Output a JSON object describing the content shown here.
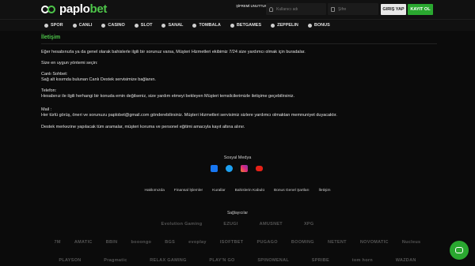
{
  "header": {
    "logo": {
      "part1": "paplo",
      "part2": "bet"
    },
    "forgot_password": "ŞİFREMİ UNUTTUM",
    "username_placeholder": "Kullanıcı adı",
    "password_placeholder": "Şifre",
    "login_label": "GIRIŞ YAP",
    "register_label": "KAYIT OL"
  },
  "nav": {
    "items": [
      "SPOR",
      "CANLI",
      "CASINO",
      "SLOT",
      "SANAL",
      "TOMBALA",
      "BETGAMES",
      "ZEPPELIN",
      "BONUS"
    ]
  },
  "page": {
    "title": "İletişim",
    "intro": "Eğer hesabınızla ya da genel olarak bahislerle ilgili bir sorunuz varsa, Müşteri Hizmetleri ekibimiz 7/24 size yardımcı olmak için buradalar.",
    "methods_heading": "Size en uygun yöntemi seçin:",
    "live_chat_title": "Canlı Sohbet:",
    "live_chat_text": "Sağ alt kısımda bulunan Canlı Destek servisimize bağlanın.",
    "phone_title": "Telefon:",
    "phone_text": "Hesabınız ile ilgili herhangi bir konuda emin değilseniz, size yardım etmeyi bekleyen Müşteri temsilcilerimizle iletişime geçebilirsiniz.",
    "mail_title": "Mail :",
    "mail_text": "Her türlü görüş, öneri ve sorunuzu paplobet@gmail.com gönderebilirsiniz. Müşteri Hizmetleri servisimiz sizlere yardımcı olmaktan memnuniyet duyacaktır.",
    "note": "Destek merkezine yapılacak tüm aramalar, müşteri koruma ve personel eğitimi amacıyla kayıt altına alınır."
  },
  "footer": {
    "social_title": "Sosyal Medya",
    "social_icons": [
      "facebook-icon",
      "twitter-icon",
      "instagram-icon",
      "youtube-icon"
    ],
    "links": [
      "Hakkımızda",
      "Finansal İşlemler",
      "Kurallar",
      "Bahislerin Kabulü",
      "Bonus Genel Şartları",
      "İletişim"
    ],
    "providers_title": "Sağlayıcılar",
    "providers_row1": [
      "Evolution Gaming",
      "EZUGI",
      "AMUSNET",
      "XPG"
    ],
    "providers_row2": [
      "7M",
      "AMATIC",
      "BBIN",
      "booongo",
      "BGS",
      "evoplay",
      "ISOFTBET",
      "PUGAGO",
      "BOOMING",
      "NETENT",
      "NOVOMATIC",
      "Nucleus"
    ],
    "providers_row3": [
      "PLAYSON",
      "Pragmatic",
      "RELAX GAMING",
      "PLAY'N GO",
      "SPINOMENAL",
      "SPRIBE",
      "tom horn",
      "WAZDAN"
    ]
  },
  "colors": {
    "accent": "#4ec64a",
    "register": "#2aa830",
    "background": "#0b0b0b"
  }
}
